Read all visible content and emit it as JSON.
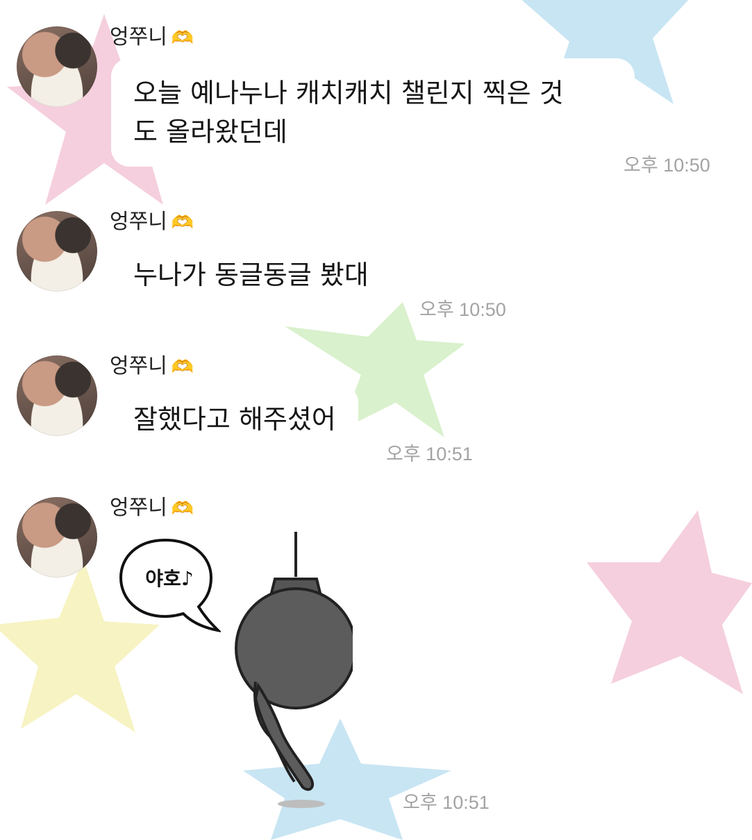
{
  "chat": {
    "messages": [
      {
        "sender": "엉쭈니",
        "sender_emoji": "🫶",
        "text": "오늘 예나누나 캐치캐치 챌린지 찍은 것",
        "text_line2": "도 올라왔던데",
        "time": "오후 10:50"
      },
      {
        "sender": "엉쭈니",
        "sender_emoji": "🫶",
        "text": "누나가 동글동글 봤대",
        "time": "오후 10:50"
      },
      {
        "sender": "엉쭈니",
        "sender_emoji": "🫶",
        "text": "잘했다고 해주셨어",
        "time": "오후 10:51"
      },
      {
        "sender": "엉쭈니",
        "sender_emoji": "🫶",
        "sticker_text": "야호♪",
        "time": "오후 10:51"
      }
    ]
  },
  "colors": {
    "star_pink": "#f4c7d8",
    "star_blue": "#bfe1f1",
    "star_green": "#d3efc4",
    "star_yellow": "#f6f1b8",
    "time_gray": "#a3a3a3"
  },
  "icons": [
    "avatar-photo",
    "heart-hands-emoji",
    "hanging-bomb-sticker"
  ]
}
